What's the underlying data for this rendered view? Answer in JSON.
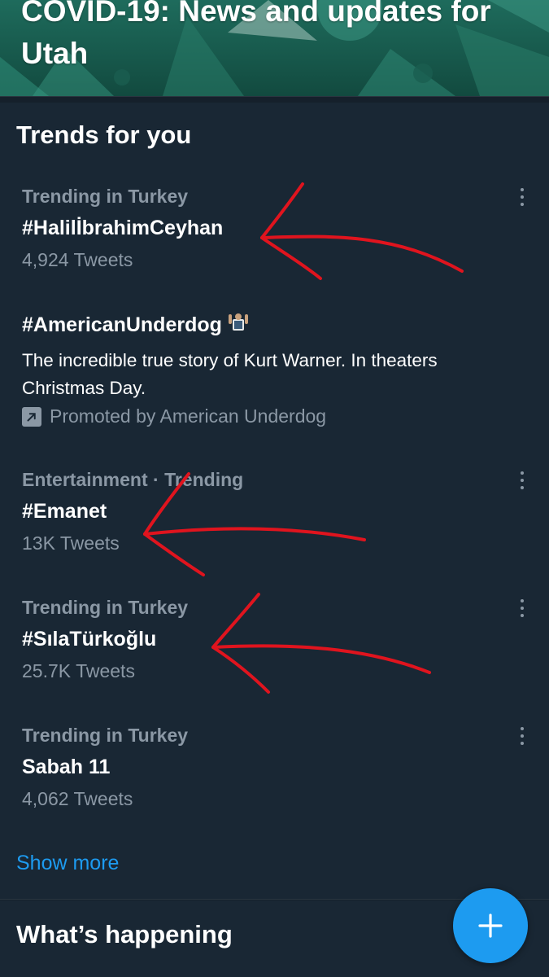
{
  "banner": {
    "title": "COVID-19: News and updates for Utah"
  },
  "trends": {
    "title": "Trends for you",
    "items": [
      {
        "context": "Trending in Turkey",
        "name": "#HalilİbrahimCeyhan",
        "count": "4,924 Tweets"
      },
      {
        "context": "Entertainment · Trending",
        "name": "#Emanet",
        "count": "13K Tweets"
      },
      {
        "context": "Trending in Turkey",
        "name": "#SılaTürkoğlu",
        "count": "25.7K Tweets"
      },
      {
        "context": "Trending in Turkey",
        "name": "Sabah 11",
        "count": "4,062 Tweets"
      }
    ],
    "promoted": {
      "name": "#AmericanUnderdog",
      "description": "The incredible true story of Kurt Warner. In theaters Christmas Day.",
      "promoted_by": "Promoted by American Underdog"
    },
    "show_more": "Show more"
  },
  "whats_happening": {
    "title": "What’s happening"
  },
  "fab": {
    "icon": "plus-icon"
  },
  "colors": {
    "background": "#15202b",
    "card": "#192734",
    "accent": "#1d9bf0",
    "muted_text": "#8b98a5",
    "annotation_red": "#e0141e"
  }
}
